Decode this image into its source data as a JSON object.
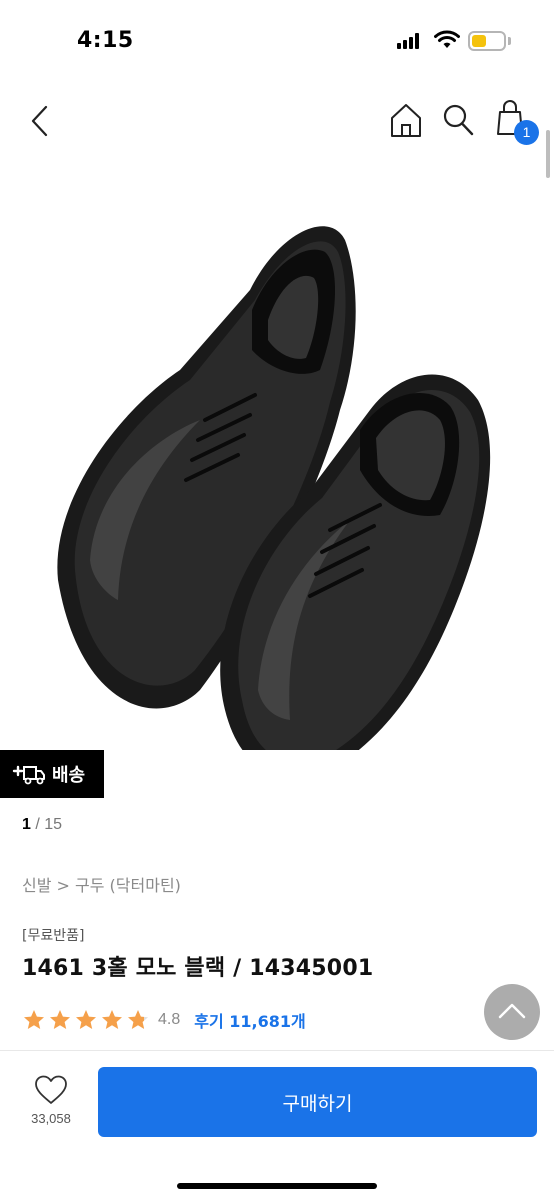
{
  "status_bar": {
    "time": "4:15",
    "battery_level_percent": 45,
    "battery_color": "#f4c20d"
  },
  "header": {
    "icons": [
      "back-arrow-icon",
      "home-icon",
      "search-icon",
      "shopping-bag-icon"
    ],
    "cart_count": "1"
  },
  "product": {
    "image_alt": "black leather lace-up shoes",
    "delivery_label": "배송",
    "image_index": "1",
    "image_total": "/ 15",
    "breadcrumb": "신발 > 구두 (닥터마틴)",
    "badge": "[무료반품]",
    "title": "1461 3홀 모노 블랙 / 14345001",
    "rating": "4.8",
    "rating_stars": 4.8,
    "reviews_label": "후기 11,681개"
  },
  "bottom_bar": {
    "like_count": "33,058",
    "buy_label": "구매하기"
  },
  "colors": {
    "accent": "#1a73e8",
    "star": "#f5a04a",
    "delivery_tag_bg": "#000000"
  }
}
